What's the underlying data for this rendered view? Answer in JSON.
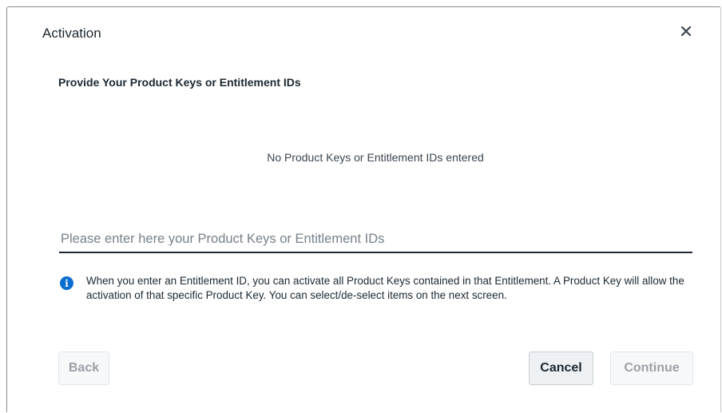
{
  "dialog": {
    "title": "Activation",
    "close_icon": "close-icon",
    "subtitle": "Provide Your Product Keys or Entitlement IDs",
    "empty_message": "No Product Keys or Entitlement IDs entered",
    "input": {
      "placeholder": "Please enter here your Product Keys or Entitlement IDs",
      "value": ""
    },
    "info": {
      "icon": "info-icon",
      "text": "When you enter an Entitlement ID, you can activate all Product Keys contained in that Entitlement. A Product Key will allow the activation of that specific Product Key. You can select/de-select items on the next screen."
    },
    "buttons": {
      "back": "Back",
      "cancel": "Cancel",
      "continue": "Continue"
    }
  },
  "colors": {
    "accent": "#0a6ed1",
    "text": "#1c2731",
    "disabled_text": "#9aa1a8"
  }
}
